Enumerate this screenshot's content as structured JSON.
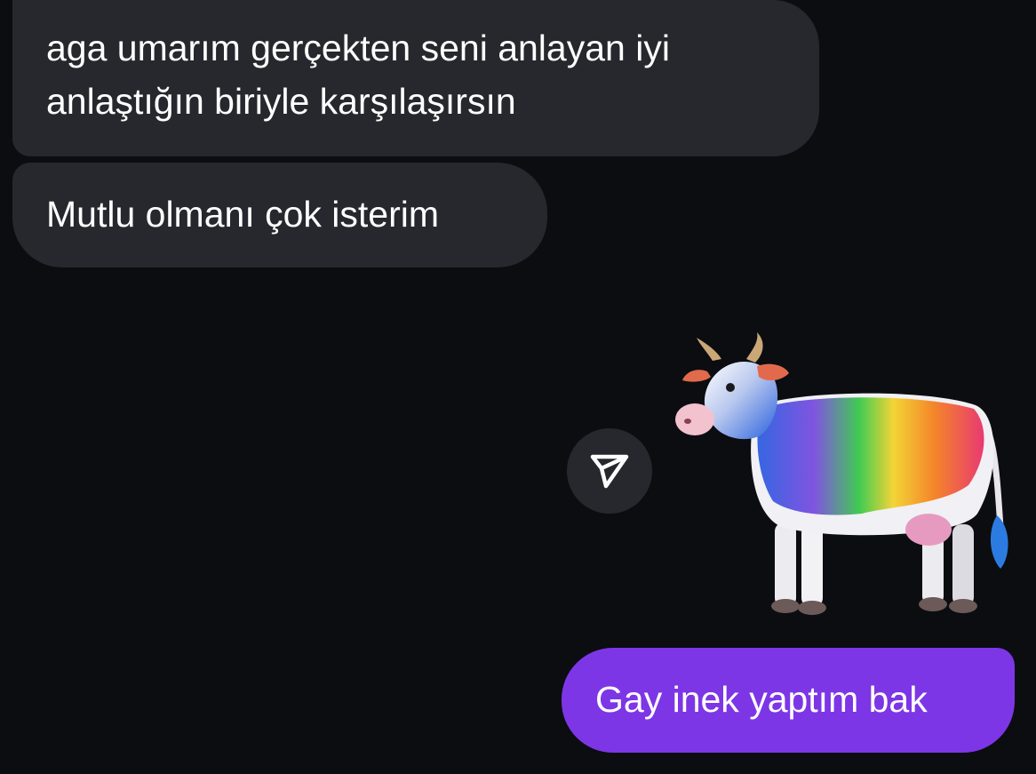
{
  "messages": {
    "incoming": [
      {
        "text": "aga umarım gerçekten seni anlayan iyi anlaştığın biriyle karşılaşırsın"
      },
      {
        "text": "Mutlu olmanı çok isterim"
      }
    ],
    "sticker": {
      "icon": "rainbow-cow-sticker"
    },
    "outgoing": [
      {
        "text": "Gay inek yaptım bak"
      }
    ]
  },
  "share_button": {
    "icon": "send-icon"
  },
  "colors": {
    "background": "#0b0d11",
    "incoming_bubble": "#26282d",
    "outgoing_bubble": "#7d36e6",
    "text": "#ffffff"
  }
}
